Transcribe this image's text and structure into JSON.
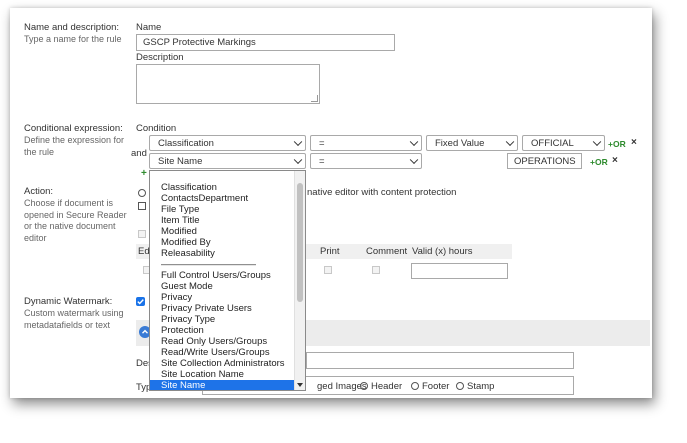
{
  "name_section": {
    "label": "Name and description:",
    "help": "Type a name for the rule",
    "name_label": "Name",
    "name_value": "GSCP Protective Markings",
    "description_label": "Description",
    "description_value": ""
  },
  "conditional": {
    "label": "Conditional expression:",
    "help": "Define the expression for the rule",
    "condition_label": "Condition",
    "and_label": "and",
    "row1": {
      "field": "Classification",
      "operator": "=",
      "value_type": "Fixed Value",
      "value": "OFFICIAL",
      "or": "OR",
      "remove": "×"
    },
    "row2": {
      "field": "Site Name",
      "operator": "=",
      "value": "OPERATIONS",
      "or": "OR",
      "remove": "×"
    },
    "add": "+"
  },
  "action": {
    "label": "Action:",
    "help": "Choose if document is opened in Secure Reader or the native document editor",
    "option_partial": "native editor with content protection",
    "columns": {
      "edit": "Edi",
      "print": "Print",
      "comment": "Comment",
      "valid": "Valid (x) hours"
    }
  },
  "watermark": {
    "label": "Dynamic Watermark:",
    "help": "Custom watermark using metadatafields or text",
    "desc_label": "Des",
    "type_label": "Typ",
    "type_options": [
      "ged Images",
      "Header",
      "Footer",
      "Stamp"
    ]
  },
  "dropdown": {
    "items": [
      "Classification",
      "ContactsDepartment",
      "File Type",
      "Item Title",
      "Modified",
      "Modified By",
      "Releasability",
      "——————————",
      "Full Control Users/Groups",
      "Guest Mode",
      "Privacy",
      "Privacy Private Users",
      "Privacy Type",
      "Protection",
      "Read Only Users/Groups",
      "Read/Write Users/Groups",
      "Site Collection Administrators",
      "Site Location Name",
      "Site Name"
    ],
    "selected_index": 18
  },
  "colors": {
    "accent": "#1e73e8",
    "or_green": "#2e8b2e",
    "checkbox_blue": "#1a73e8"
  }
}
